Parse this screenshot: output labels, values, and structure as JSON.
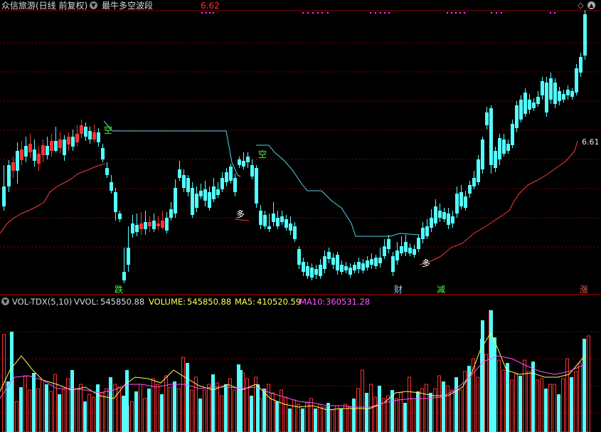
{
  "header": {
    "stock_name": "众信旅游",
    "period_label": "(日线 前复权)",
    "indicator_name": "最牛多空波段",
    "price_high_label": "6.62",
    "icon_dropdown": "chevron-down-icon",
    "icon_settings": "diamond-icon",
    "icon_up": "triangle-up-icon"
  },
  "price_pane": {
    "right_price_label": "6.61",
    "signals": {
      "kong1": "空",
      "kong2": "空",
      "duo1": "多",
      "duo2": "多",
      "die": "跌",
      "cai": "财",
      "jian": "减",
      "zhang": "涨"
    }
  },
  "volume_pane": {
    "name": "VOL-TDX(5,10)",
    "vvol_label": "VVOL:",
    "vvol_value": "545850.88",
    "volume_label": "VOLUME:",
    "volume_value": "545850.88",
    "ma5_label": "MA5:",
    "ma5_value": "410520.59",
    "ma10_label": "MA10:",
    "ma10_value": "360531.28"
  },
  "colors": {
    "up": "#ff3232",
    "down": "#54ffff",
    "grid": "#8b0000",
    "stop_up": "#ff3c3c",
    "stop_down": "#4fd6e6",
    "ma5": "#ffff54",
    "ma10": "#ff54ff",
    "white": "#ffffff"
  },
  "chart_data": {
    "type": "candlestick",
    "candles": [
      [
        1,
        0,
        0,
        0,
        0
      ]
    ],
    "volume_bars": "one per candle",
    "price_high": 6.62,
    "stop_line_last": 6.61
  }
}
